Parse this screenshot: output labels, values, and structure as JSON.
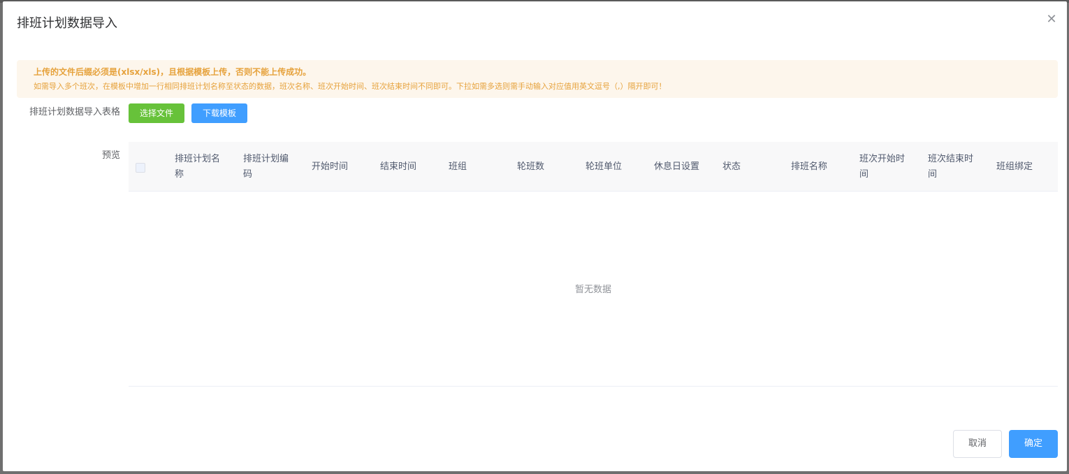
{
  "dialog": {
    "title": "排班计划数据导入",
    "close_icon": "close-icon"
  },
  "alert": {
    "title": "上传的文件后缀必须是(xlsx/xls)，且根据模板上传，否则不能上传成功。",
    "description": "如需导入多个班次，在模板中增加一行相同排班计划名称至状态的数据，班次名称、班次开始时间、班次结束时间不同即可。下拉如需多选则需手动输入对应值用英文逗号（,）隔开即可！",
    "color": "#e6a23c",
    "background": "#fdf6ec"
  },
  "form": {
    "upload_label": "排班计划数据导入表格",
    "select_file_label": "选择文件",
    "download_template_label": "下载模板",
    "preview_label": "预览"
  },
  "table": {
    "columns": [
      "排班计划名称",
      "排班计划编码",
      "开始时间",
      "结束时间",
      "班组",
      "轮班数",
      "轮班单位",
      "休息日设置",
      "状态",
      "排班名称",
      "班次开始时间",
      "班次结束时间",
      "班组绑定"
    ],
    "empty_text": "暂无数据"
  },
  "footer": {
    "cancel_label": "取消",
    "confirm_label": "确定"
  },
  "colors": {
    "primary": "#409eff",
    "success": "#67c23a"
  }
}
